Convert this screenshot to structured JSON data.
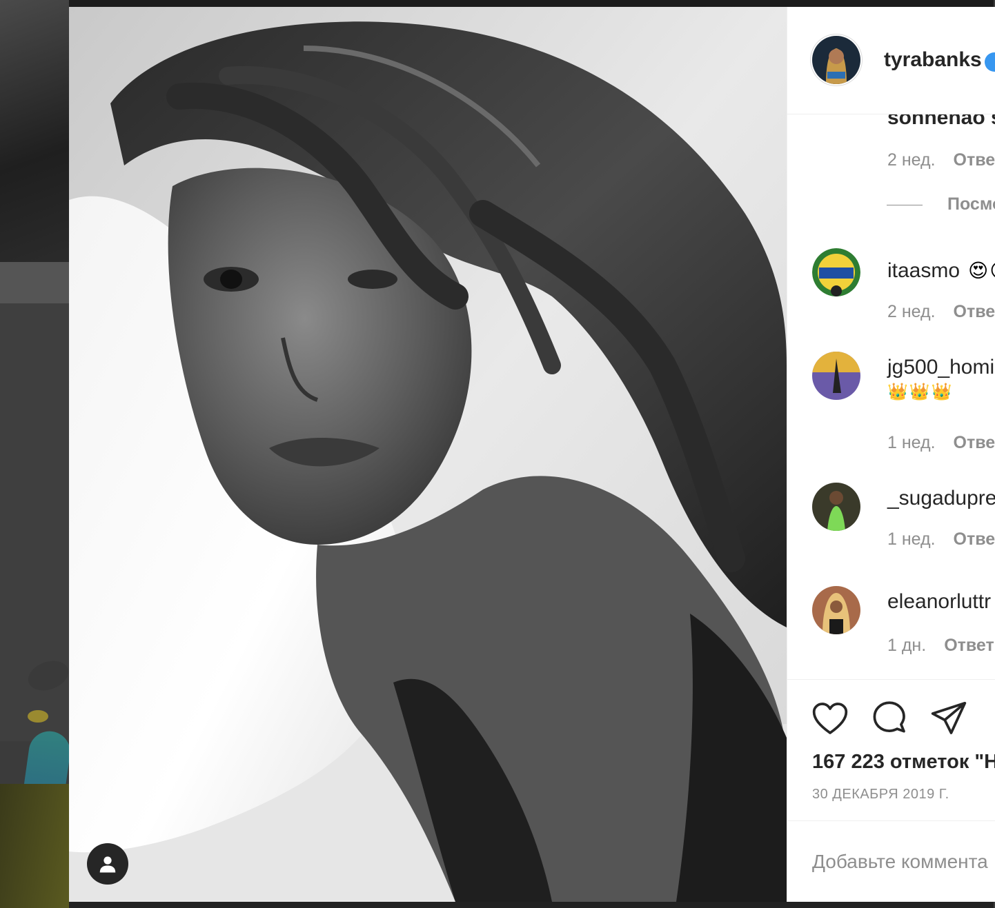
{
  "post": {
    "username": "tyrabanks",
    "verified_icon": "verified-badge-icon",
    "likes": "167 223 отметок \"Н",
    "date": "30 ДЕКАБРЯ 2019 Г.",
    "add_comment_placeholder": "Добавьте коммента"
  },
  "partial_comment": {
    "username": "sonnenao s",
    "time": "2 нед.",
    "reply": "Ответ"
  },
  "view_more": "Посмо",
  "comments": [
    {
      "username": "itaasmo",
      "emoji": "😍😍",
      "time": "2 нед.",
      "reply": "Ответ"
    },
    {
      "username": "jg500_homi",
      "emoji": "👑👑👑",
      "time": "1 нед.",
      "reply": "Отве"
    },
    {
      "username": "_sugadupre",
      "emoji": "",
      "time": "1 нед.",
      "reply": "Отве"
    },
    {
      "username": "eleanorluttr",
      "emoji": "",
      "time": "1 дн.",
      "reply": "Ответ"
    }
  ],
  "actions": {
    "like_icon": "heart-icon",
    "comment_icon": "comment-bubble-icon",
    "share_icon": "paper-plane-icon",
    "tag_icon": "user-tag-icon"
  },
  "colors": {
    "text_primary": "#262626",
    "text_secondary": "#8e8e8e",
    "verified": "#3897f0",
    "divider": "#efefef"
  }
}
